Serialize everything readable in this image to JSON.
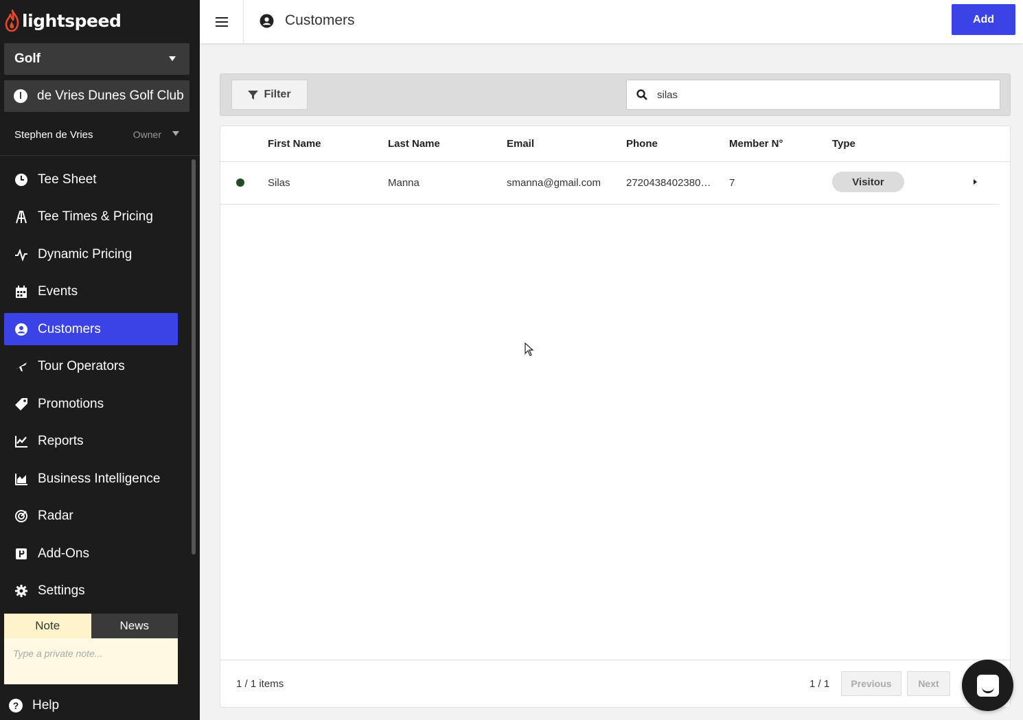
{
  "app": {
    "brand": "lightspeed",
    "accent_color": "#3b43e6",
    "brand_color": "#e8472b"
  },
  "sidebar": {
    "product_select": "Golf",
    "club_select": "de Vries Dunes Golf Club",
    "user": {
      "name": "Stephen de Vries",
      "role": "Owner"
    },
    "items": [
      {
        "label": "Tee Sheet",
        "icon": "clock-icon"
      },
      {
        "label": "Tee Times & Pricing",
        "icon": "golfer-icon"
      },
      {
        "label": "Dynamic Pricing",
        "icon": "pulse-icon"
      },
      {
        "label": "Events",
        "icon": "calendar-icon"
      },
      {
        "label": "Customers",
        "icon": "user-circle-icon",
        "active": true
      },
      {
        "label": "Tour Operators",
        "icon": "plane-icon"
      },
      {
        "label": "Promotions",
        "icon": "tag-icon"
      },
      {
        "label": "Reports",
        "icon": "chart-line-icon"
      },
      {
        "label": "Business Intelligence",
        "icon": "chart-area-icon"
      },
      {
        "label": "Radar",
        "icon": "radar-icon"
      },
      {
        "label": "Add-Ons",
        "icon": "puzzle-icon"
      },
      {
        "label": "Settings",
        "icon": "gear-icon"
      }
    ],
    "notes": {
      "tab_note": "Note",
      "tab_news": "News",
      "placeholder": "Type a private note..."
    },
    "help": "Help"
  },
  "header": {
    "title": "Customers",
    "add_label": "Add"
  },
  "filter": {
    "filter_label": "Filter",
    "search_value": "silas"
  },
  "table": {
    "columns": [
      "First Name",
      "Last Name",
      "Email",
      "Phone",
      "Member N°",
      "Type"
    ],
    "rows": [
      {
        "first_name": "Silas",
        "last_name": "Manna",
        "email": "smanna@gmail.com",
        "phone": "2720438402380…",
        "member_no": "7",
        "type": "Visitor",
        "status_color": "#1e4d28"
      }
    ],
    "footer": {
      "items": "1 / 1 items",
      "page": "1 / 1",
      "prev": "Previous",
      "next": "Next"
    }
  }
}
